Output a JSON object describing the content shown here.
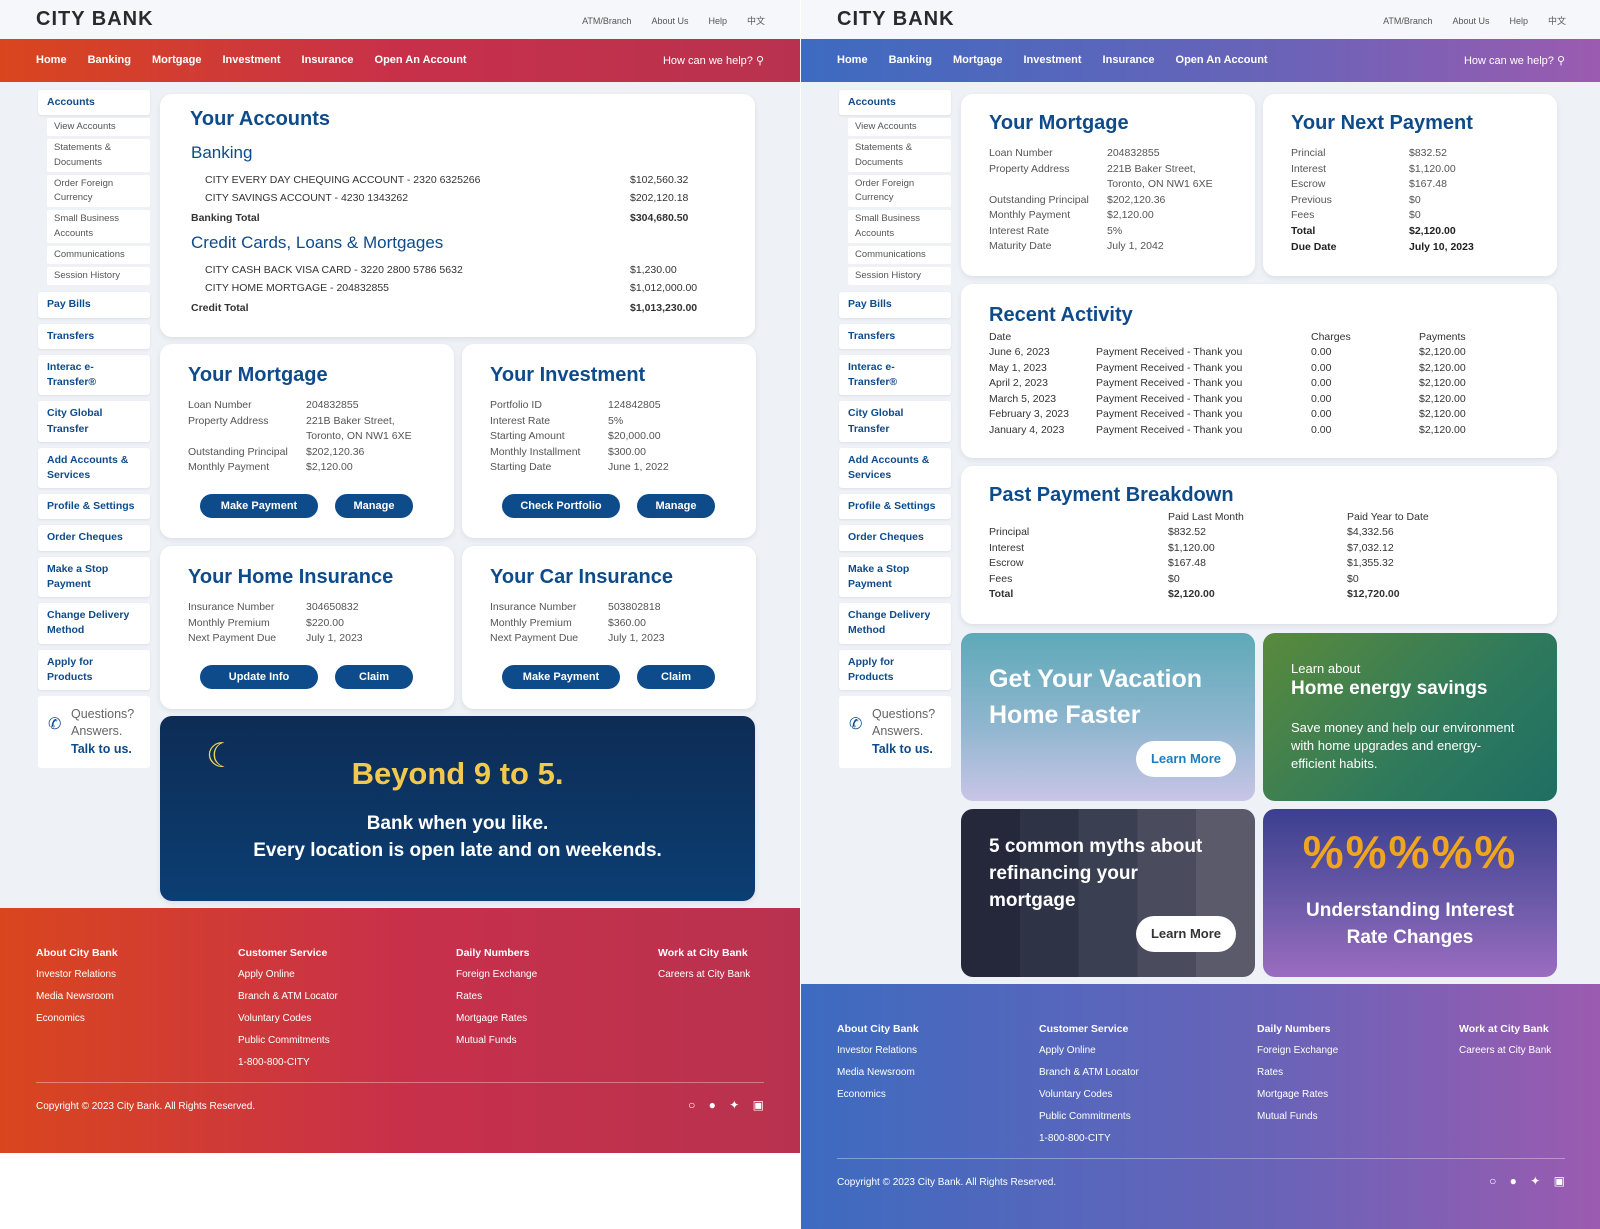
{
  "brand": {
    "logo": "CITY BANK"
  },
  "toplinks": [
    "ATM/Branch",
    "About Us",
    "Help",
    "中文"
  ],
  "nav": {
    "items": [
      "Home",
      "Banking",
      "Mortgage",
      "Investment",
      "Insurance",
      "Open An Account"
    ],
    "help": "How can we help?"
  },
  "sidebar": {
    "accounts": "Accounts",
    "sub": [
      "View Accounts",
      "Statements & Documents",
      "Order Foreign Currency",
      "Small Business Accounts",
      "Communications",
      "Session History"
    ],
    "items": [
      "Pay Bills",
      "Transfers",
      "Interac e-Transfer®",
      "City Global Transfer",
      "Add Accounts & Services",
      "Profile & Settings",
      "Order Cheques",
      "Make a Stop Payment",
      "Change Delivery Method",
      "Apply for Products"
    ],
    "question": {
      "l1": "Questions?",
      "l2": "Answers.",
      "l3": "Talk to us."
    }
  },
  "left": {
    "accounts": {
      "title": "Your Accounts",
      "banking": "Banking",
      "rows1": [
        {
          "name": "CITY EVERY DAY CHEQUING ACCOUNT - 2320 6325266",
          "val": "$102,560.32"
        },
        {
          "name": "CITY SAVINGS ACCOUNT - 4230 1343262",
          "val": "$202,120.18"
        }
      ],
      "banking_total_label": "Banking Total",
      "banking_total": "$304,680.50",
      "credit": "Credit Cards, Loans & Mortgages",
      "rows2": [
        {
          "name": "CITY CASH BACK VISA CARD - 3220 2800 5786 5632",
          "val": "$1,230.00"
        },
        {
          "name": "CITY HOME MORTGAGE - 204832855",
          "val": "$1,012,000.00"
        }
      ],
      "credit_total_label": "Credit Total",
      "credit_total": "$1,013,230.00"
    },
    "mortgage": {
      "title": "Your Mortgage",
      "rows": [
        [
          "Loan Number",
          "204832855"
        ],
        [
          "Property Address",
          "221B Baker Street,"
        ],
        [
          "",
          "Toronto, ON NW1 6XE"
        ],
        [
          "Outstanding Principal",
          "$202,120.36"
        ],
        [
          "Monthly Payment",
          "$2,120.00"
        ]
      ],
      "b1": "Make Payment",
      "b2": "Manage"
    },
    "investment": {
      "title": "Your Investment",
      "rows": [
        [
          "Portfolio ID",
          "124842805"
        ],
        [
          "Interest Rate",
          "5%"
        ],
        [
          "Starting Amount",
          "$20,000.00"
        ],
        [
          "Monthly Installment",
          "$300.00"
        ],
        [
          "Starting Date",
          "June 1, 2022"
        ]
      ],
      "b1": "Check Portfolio",
      "b2": "Manage"
    },
    "home": {
      "title": "Your Home Insurance",
      "rows": [
        [
          "Insurance Number",
          "304650832"
        ],
        [
          "Monthly Premium",
          "$220.00"
        ],
        [
          "Next Payment Due",
          "July 1, 2023"
        ]
      ],
      "b1": "Update Info",
      "b2": "Claim"
    },
    "car": {
      "title": "Your Car Insurance",
      "rows": [
        [
          "Insurance Number",
          "503802818"
        ],
        [
          "Monthly Premium",
          "$360.00"
        ],
        [
          "Next Payment Due",
          "July 1, 2023"
        ]
      ],
      "b1": "Make Payment",
      "b2": "Claim"
    },
    "banner": {
      "title": "Beyond 9 to 5.",
      "l1": "Bank when you like.",
      "l2": "Every location is open late and on weekends."
    }
  },
  "right": {
    "mortgage": {
      "title": "Your Mortgage",
      "rows": [
        [
          "Loan Number",
          "204832855"
        ],
        [
          "Property Address",
          "221B Baker Street,"
        ],
        [
          "",
          "Toronto, ON NW1 6XE"
        ],
        [
          "Outstanding Principal",
          "$202,120.36"
        ],
        [
          "Monthly Payment",
          "$2,120.00"
        ],
        [
          "Interest Rate",
          "5%"
        ],
        [
          "Maturity Date",
          "July 1, 2042"
        ]
      ]
    },
    "next": {
      "title": "Your Next Payment",
      "rows": [
        [
          "Princial",
          "$832.52"
        ],
        [
          "Interest",
          "$1,120.00"
        ],
        [
          "Escrow",
          "$167.48"
        ],
        [
          "Previous",
          "$0"
        ],
        [
          "Fees",
          "$0"
        ]
      ],
      "total_label": "Total",
      "total": "$2,120.00",
      "due_label": "Due Date",
      "due": "July 10, 2023"
    },
    "activity": {
      "title": "Recent Activity",
      "headers": [
        "Date",
        "",
        "Charges",
        "Payments"
      ],
      "rows": [
        [
          "June 6, 2023",
          "Payment Received - Thank you",
          "0.00",
          "$2,120.00"
        ],
        [
          "May 1, 2023",
          "Payment Received - Thank you",
          "0.00",
          "$2,120.00"
        ],
        [
          "April 2, 2023",
          "Payment Received - Thank you",
          "0.00",
          "$2,120.00"
        ],
        [
          "March 5, 2023",
          "Payment Received - Thank you",
          "0.00",
          "$2,120.00"
        ],
        [
          "February 3, 2023",
          "Payment Received - Thank you",
          "0.00",
          "$2,120.00"
        ],
        [
          "January 4, 2023",
          "Payment Received - Thank you",
          "0.00",
          "$2,120.00"
        ]
      ]
    },
    "breakdown": {
      "title": "Past Payment Breakdown",
      "headers": [
        "",
        "Paid Last Month",
        "Paid Year to Date"
      ],
      "rows": [
        [
          "Principal",
          "$832.52",
          "$4,332.56"
        ],
        [
          "Interest",
          "$1,120.00",
          "$7,032.12"
        ],
        [
          "Escrow",
          "$167.48",
          "$1,355.32"
        ],
        [
          "Fees",
          "$0",
          "$0"
        ]
      ],
      "total": [
        "Total",
        "$2,120.00",
        "$12,720.00"
      ]
    },
    "promo1": {
      "title1": "Get Your Vacation",
      "title2": "Home Faster",
      "cta": "Learn More"
    },
    "promo2": {
      "pre": "Learn about",
      "title": "Home energy savings",
      "l1": "Save money and help our environment",
      "l2": "with home upgrades and energy-",
      "l3": "efficient habits."
    },
    "promo3": {
      "l1": "5 common myths about",
      "l2": "refinancing your",
      "l3": "mortgage",
      "cta": "Learn More"
    },
    "promo4": {
      "pct": "%%%%%",
      "l1": "Understanding Interest",
      "l2": "Rate Changes"
    }
  },
  "footer": {
    "cols": [
      {
        "h": "About City Bank",
        "items": [
          "Investor Relations",
          "Media Newsroom",
          "Economics"
        ]
      },
      {
        "h": "Customer Service",
        "items": [
          "Apply Online",
          "Branch & ATM Locator",
          "Voluntary Codes",
          "Public Commitments",
          "1-800-800-CITY"
        ]
      },
      {
        "h": "Daily Numbers",
        "items": [
          "Foreign Exchange",
          "Rates",
          "Mortgage Rates",
          "Mutual Funds"
        ]
      },
      {
        "h": "Work at City Bank",
        "items": [
          "Careers at City Bank"
        ]
      }
    ],
    "copyright": "Copyright © 2023 City Bank. All Rights Reserved."
  },
  "colors": {
    "brand_blue": "#0e4b8a",
    "red_gradient_start": "#d9461e",
    "blue_gradient_start": "#3d6bc0",
    "banner_bg": "#0d3a6e",
    "banner_title": "#f2c94c"
  },
  "icons": [
    "search-icon",
    "phone-icon",
    "moon-icon",
    "instagram-icon",
    "facebook-icon",
    "twitter-icon",
    "linkedin-icon"
  ]
}
